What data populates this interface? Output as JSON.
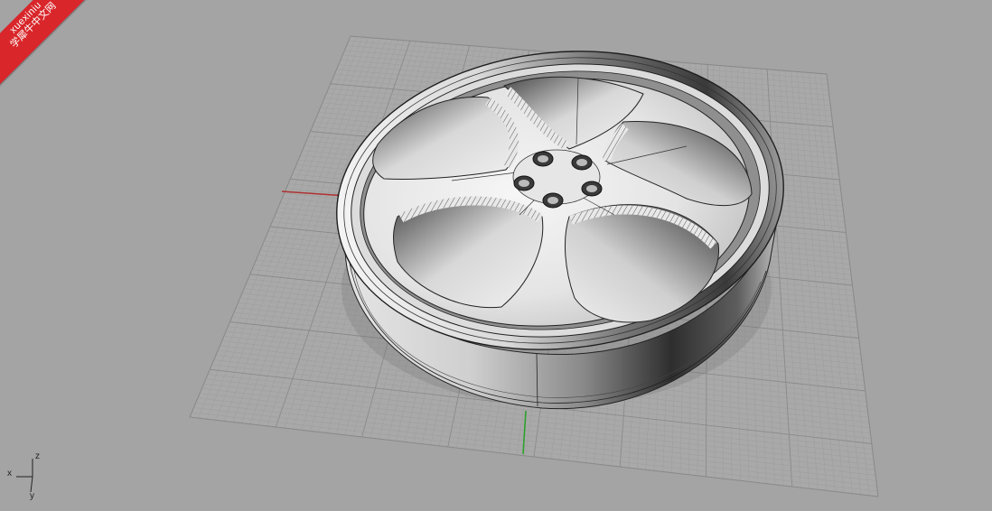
{
  "watermark": {
    "line1": "xuexiniu",
    "line2": "学犀牛中文网",
    "color": "#d8262a"
  },
  "axis_widget": {
    "x_label": "x",
    "y_label": "y",
    "z_label": "z"
  },
  "colors": {
    "background": "#a4a4a4",
    "grid_minor": "#999999",
    "grid_major": "#8c8c8c",
    "x_axis": "#b03030",
    "y_axis": "#2ea02e",
    "wheel_light": "#f2f2f2",
    "wheel_dark": "#2a2a2a"
  }
}
